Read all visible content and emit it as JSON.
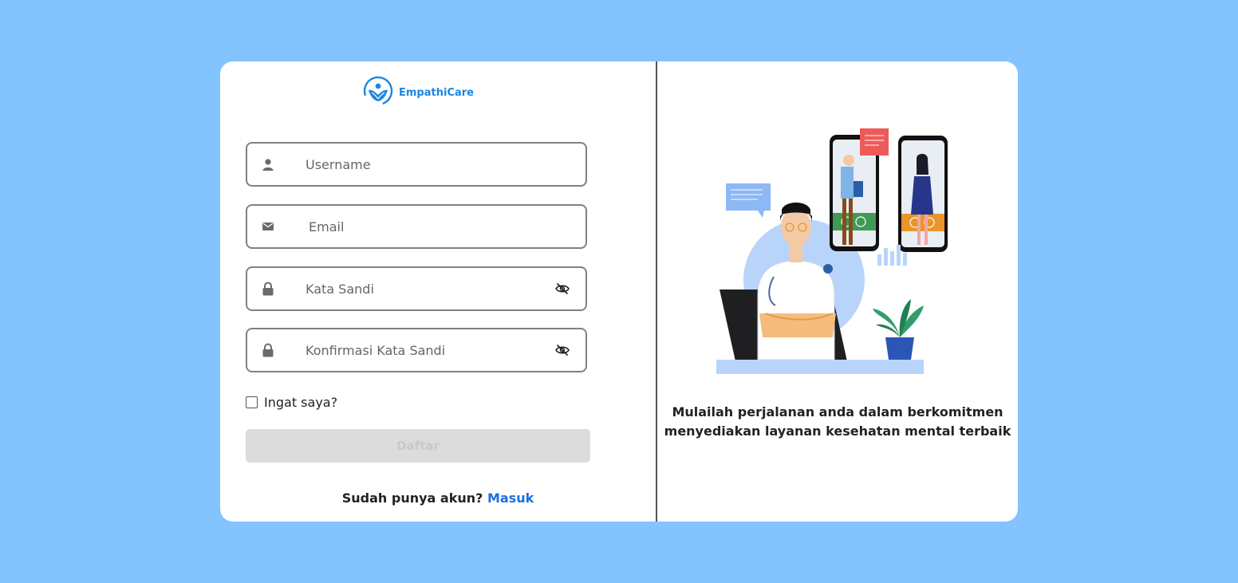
{
  "brand": {
    "name": "EmpathiCare",
    "color": "#1c86e0"
  },
  "form": {
    "username": {
      "placeholder": "Username",
      "icon": "user-icon"
    },
    "email": {
      "placeholder": "Email",
      "icon": "mail-icon"
    },
    "password": {
      "placeholder": "Kata Sandi",
      "icon": "lock-icon",
      "toggle_icon": "eye-off-icon"
    },
    "confirm_password": {
      "placeholder": "Konfirmasi Kata Sandi",
      "icon": "lock-icon",
      "toggle_icon": "eye-off-icon"
    },
    "remember_label": "Ingat saya?",
    "submit_label": "Daftar"
  },
  "footer": {
    "prompt": "Sudah punya akun?",
    "login_link": "Masuk"
  },
  "tagline": {
    "line1": "Mulailah perjalanan anda dalam berkomitmen",
    "line2": "menyediakan layanan kesehatan mental terbaik"
  },
  "colors": {
    "background": "#83c3fe",
    "link": "#1c6fe0",
    "button_disabled": "#dcdcdc"
  }
}
